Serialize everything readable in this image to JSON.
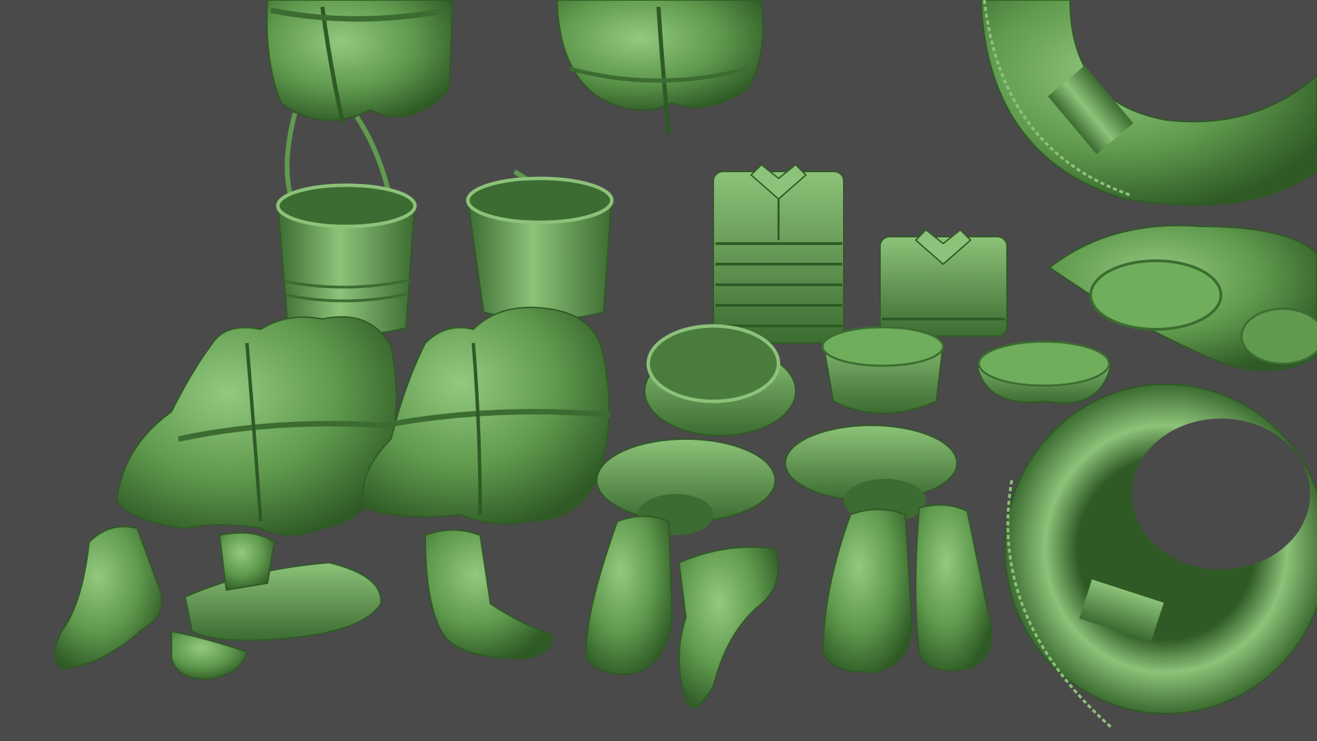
{
  "scene": {
    "background_color": "#4a4a4a",
    "material_color": "#5f9a4e",
    "material_light": "#8cc279",
    "material_dark": "#2f5a25",
    "objects": [
      "life-jacket",
      "life-jacket",
      "bucket",
      "bucket",
      "folded-shirt-stack",
      "folded-shirt",
      "life-jacket",
      "life-jacket",
      "peaked-cap",
      "sailor-cap",
      "sailor-cap",
      "sailor-cap-pile",
      "boot",
      "life-ring",
      "life-ring"
    ]
  }
}
